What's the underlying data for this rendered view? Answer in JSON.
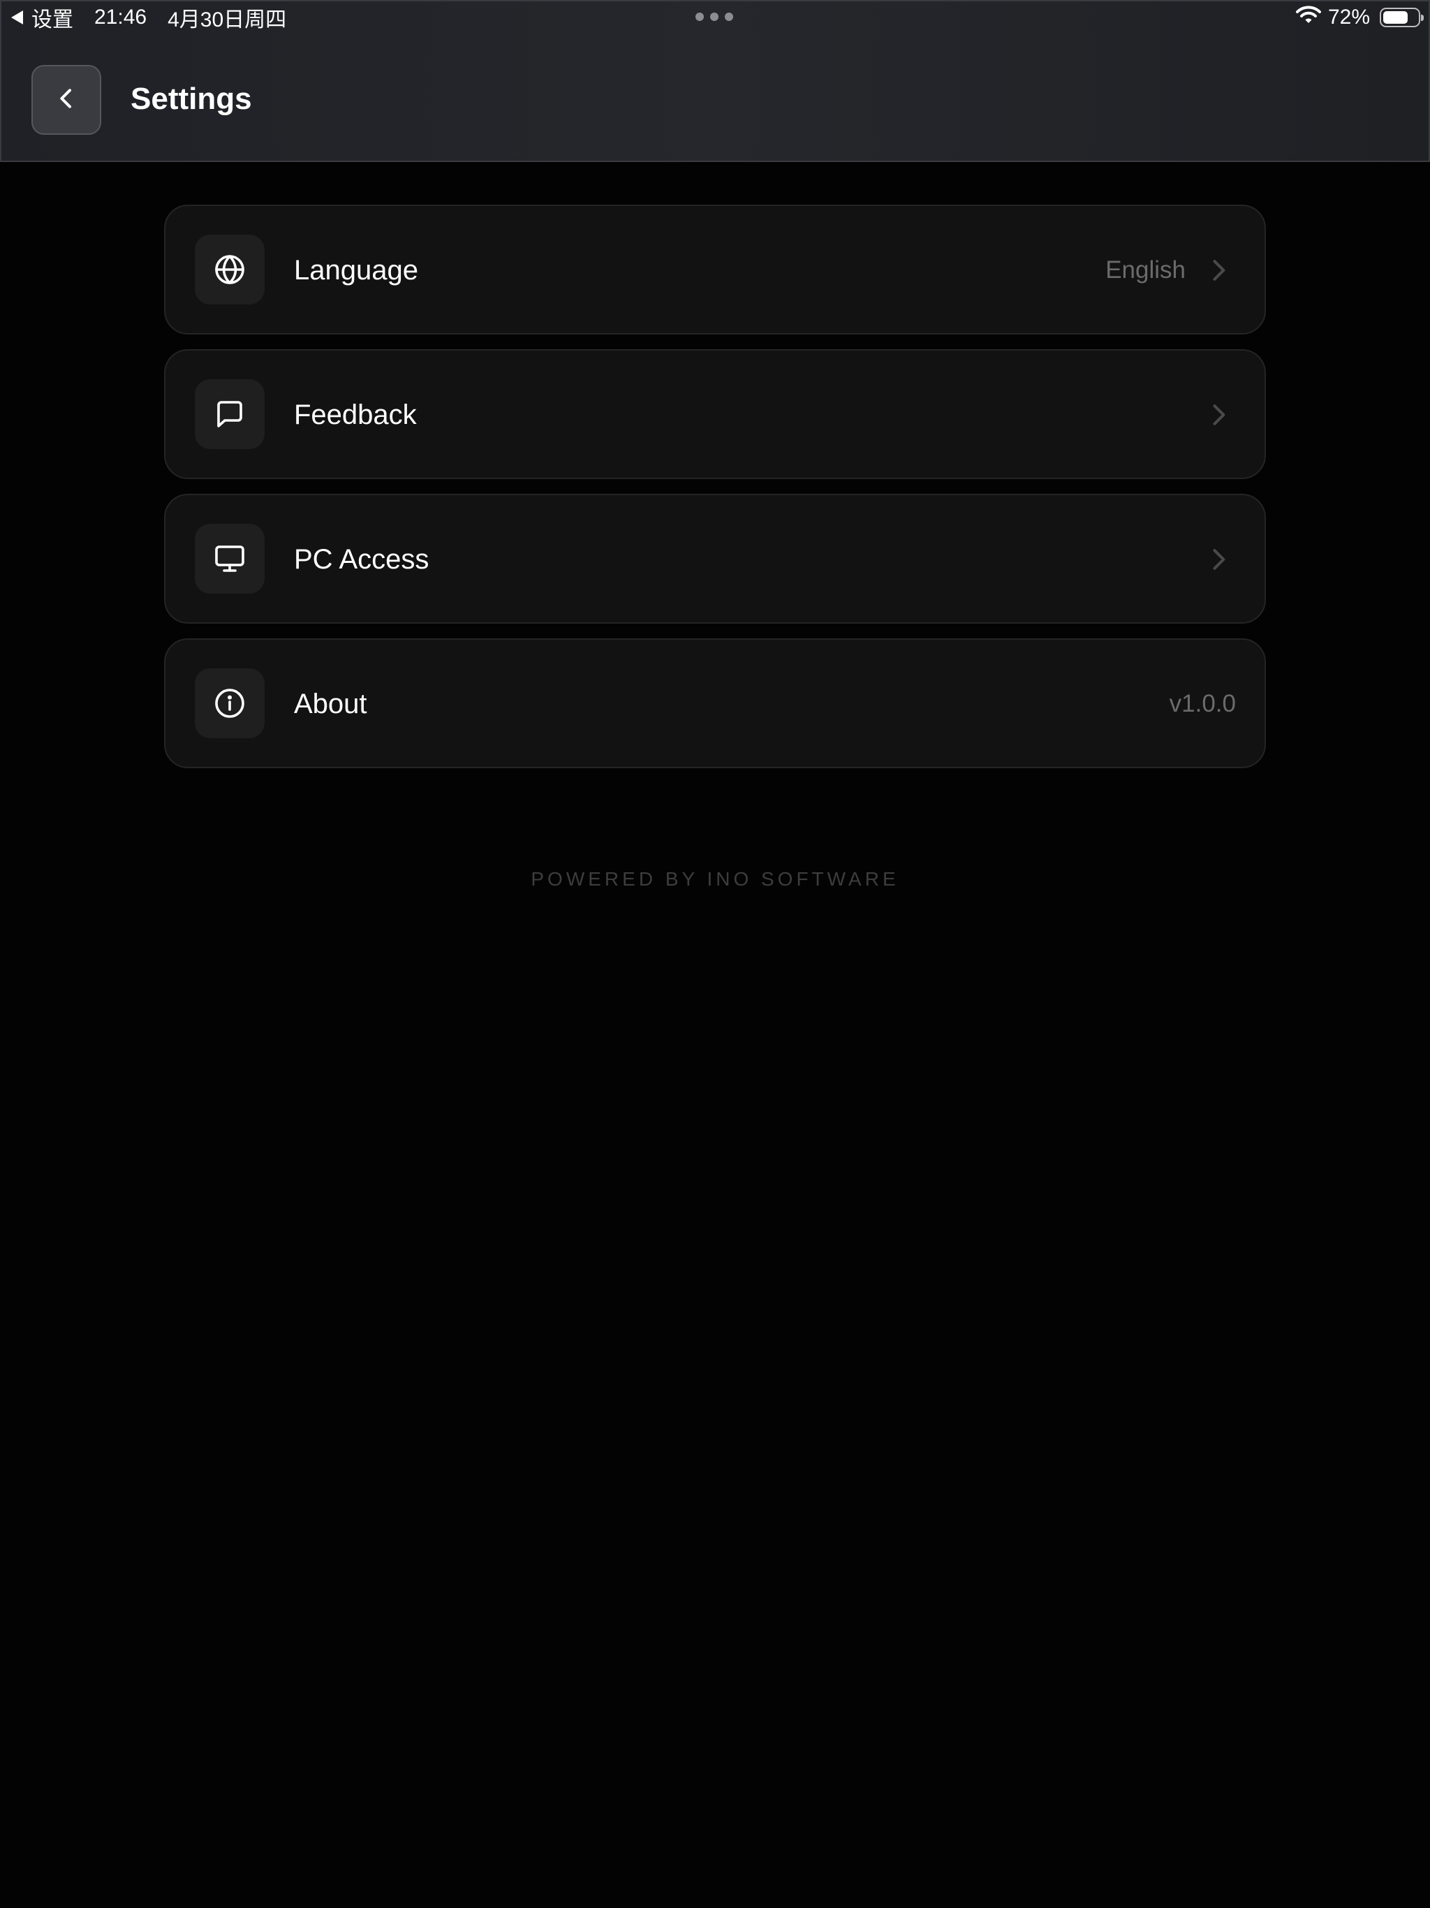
{
  "status_bar": {
    "back_app": "设置",
    "time": "21:46",
    "date": "4月30日周四",
    "battery_text": "72%",
    "battery_level": 0.72
  },
  "header": {
    "title": "Settings",
    "back_icon": "chevron-left-icon"
  },
  "settings": [
    {
      "label": "Language",
      "value": "English",
      "icon": "globe-icon",
      "has_chevron": true
    },
    {
      "label": "Feedback",
      "value": "",
      "icon": "message-square-icon",
      "has_chevron": true
    },
    {
      "label": "PC Access",
      "value": "",
      "icon": "monitor-icon",
      "has_chevron": true
    },
    {
      "label": "About",
      "value": "v1.0.0",
      "icon": "info-icon",
      "has_chevron": false
    }
  ],
  "footer": {
    "text": "POWERED BY INO SOFTWARE"
  },
  "colors": {
    "background": "#030303",
    "header_background": "#232429",
    "card_background": "#121212",
    "card_border": "#242424",
    "secondary_text": "#6b6b6b",
    "footer_text": "#3d3d3d"
  }
}
